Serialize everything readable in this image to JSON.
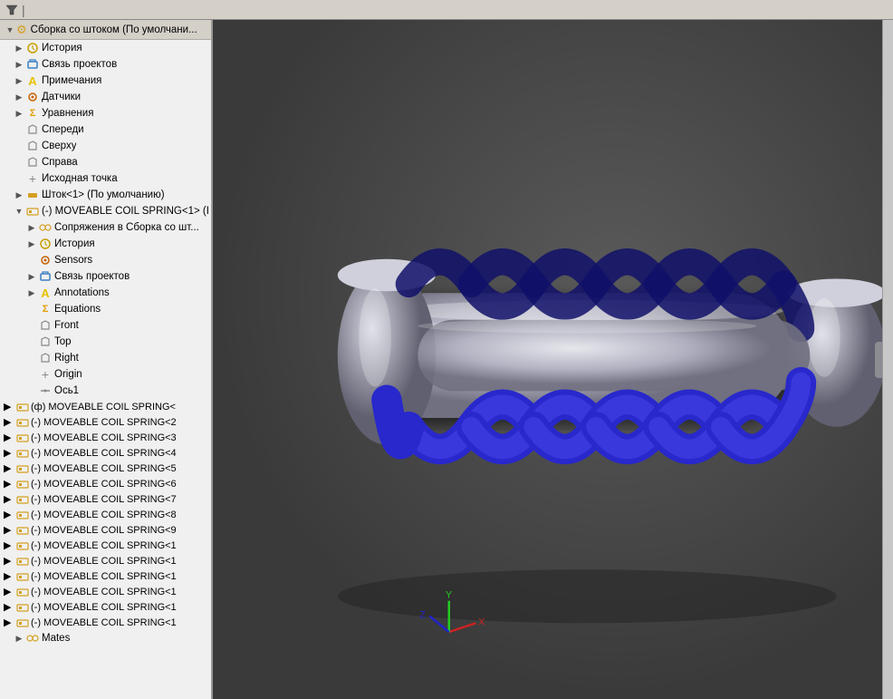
{
  "toolbar": {
    "filter_icon": "⚙",
    "filter_label": ""
  },
  "tree": {
    "header": {
      "title": "Сборка со штоком (По умолчани..."
    },
    "items": [
      {
        "id": "history",
        "label": "История",
        "icon": "history",
        "indent": 1,
        "expandable": true
      },
      {
        "id": "project-link",
        "label": "Связь проектов",
        "icon": "link",
        "indent": 1,
        "expandable": true
      },
      {
        "id": "notes",
        "label": "Примечания",
        "icon": "note",
        "indent": 1,
        "expandable": true
      },
      {
        "id": "sensors",
        "label": "Датчики",
        "icon": "sensor",
        "indent": 1,
        "expandable": true
      },
      {
        "id": "equations",
        "label": "Уравнения",
        "icon": "equation",
        "indent": 1,
        "expandable": true
      },
      {
        "id": "front",
        "label": "Спереди",
        "icon": "plane",
        "indent": 1,
        "expandable": false
      },
      {
        "id": "top",
        "label": "Сверху",
        "icon": "plane",
        "indent": 1,
        "expandable": false
      },
      {
        "id": "right",
        "label": "Справа",
        "icon": "plane",
        "indent": 1,
        "expandable": false
      },
      {
        "id": "origin",
        "label": "Исходная точка",
        "icon": "origin",
        "indent": 1,
        "expandable": false
      },
      {
        "id": "rod",
        "label": "Шток<1> (По умолчанию)",
        "icon": "part",
        "indent": 1,
        "expandable": true
      },
      {
        "id": "coil-spring-main",
        "label": "(-) MOVEABLE COIL SPRING<1> (I",
        "icon": "assembly",
        "indent": 1,
        "expandable": true
      },
      {
        "id": "mates-in-assembly",
        "label": "Сопряжения в Сборка со шт...",
        "icon": "mates",
        "indent": 2,
        "expandable": true
      },
      {
        "id": "history2",
        "label": "История",
        "icon": "history",
        "indent": 2,
        "expandable": true
      },
      {
        "id": "sensors2",
        "label": "Sensors",
        "icon": "sensor",
        "indent": 2,
        "expandable": false
      },
      {
        "id": "project-link2",
        "label": "Связь проектов",
        "icon": "link",
        "indent": 2,
        "expandable": true
      },
      {
        "id": "annotations",
        "label": "Annotations",
        "icon": "note",
        "indent": 2,
        "expandable": true
      },
      {
        "id": "equations2",
        "label": "Equations",
        "icon": "equation",
        "indent": 2,
        "expandable": false
      },
      {
        "id": "front2",
        "label": "Front",
        "icon": "plane",
        "indent": 2,
        "expandable": false
      },
      {
        "id": "top2",
        "label": "Top",
        "icon": "plane",
        "indent": 2,
        "expandable": false
      },
      {
        "id": "right2",
        "label": "Right",
        "icon": "plane",
        "indent": 2,
        "expandable": false
      },
      {
        "id": "origin2",
        "label": "Origin",
        "icon": "origin",
        "indent": 2,
        "expandable": false
      },
      {
        "id": "axis1",
        "label": "Ось1",
        "icon": "axis",
        "indent": 2,
        "expandable": false
      }
    ],
    "coil_items": [
      {
        "label": "(ф) MOVEABLE COIL SPRING<",
        "prefix": "(ф)"
      },
      {
        "label": "(-) MOVEABLE COIL SPRING<2",
        "prefix": "(-)"
      },
      {
        "label": "(-) MOVEABLE COIL SPRING<3",
        "prefix": "(-)"
      },
      {
        "label": "(-) MOVEABLE COIL SPRING<4",
        "prefix": "(-)"
      },
      {
        "label": "(-) MOVEABLE COIL SPRING<5",
        "prefix": "(-)"
      },
      {
        "label": "(-) MOVEABLE COIL SPRING<6",
        "prefix": "(-)"
      },
      {
        "label": "(-) MOVEABLE COIL SPRING<7",
        "prefix": "(-)"
      },
      {
        "label": "(-) MOVEABLE COIL SPRING<8",
        "prefix": "(-)"
      },
      {
        "label": "(-) MOVEABLE COIL SPRING<9",
        "prefix": "(-)"
      },
      {
        "label": "(-) MOVEABLE COIL SPRING<1",
        "prefix": "(-)"
      },
      {
        "label": "(-) MOVEABLE COIL SPRING<1",
        "prefix": "(-)"
      },
      {
        "label": "(-) MOVEABLE COIL SPRING<1",
        "prefix": "(-)"
      },
      {
        "label": "(-) MOVEABLE COIL SPRING<1",
        "prefix": "(-)"
      },
      {
        "label": "(-) MOVEABLE COIL SPRING<1",
        "prefix": "(-)"
      },
      {
        "label": "(-) MOVEABLE COIL SPRING<1",
        "prefix": "(-)"
      }
    ],
    "mates_label": "Mates"
  },
  "viewport": {
    "bg_color": "#444444"
  }
}
